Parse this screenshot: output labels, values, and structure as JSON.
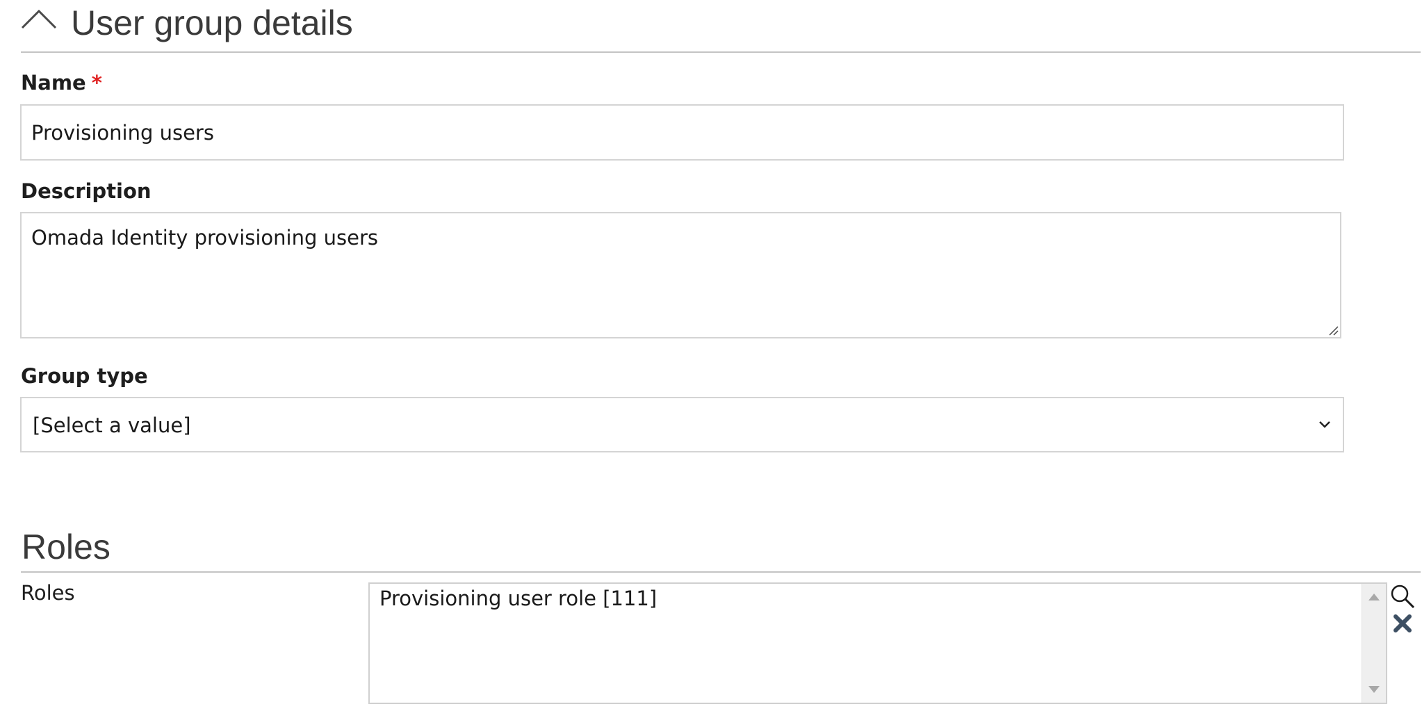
{
  "details": {
    "title": "User group details",
    "fields": {
      "name": {
        "label": "Name",
        "required_marker": "*",
        "value": "Provisioning users"
      },
      "description": {
        "label": "Description",
        "value": "Omada Identity provisioning users"
      },
      "group_type": {
        "label": "Group type",
        "selected": "[Select a value]"
      }
    }
  },
  "roles": {
    "title": "Roles",
    "label": "Roles",
    "items": [
      "Provisioning user role [111]"
    ]
  },
  "icons": {
    "collapse": "chevron-up-icon",
    "select": "chevron-down-icon",
    "search": "search-icon",
    "clear": "close-icon"
  }
}
